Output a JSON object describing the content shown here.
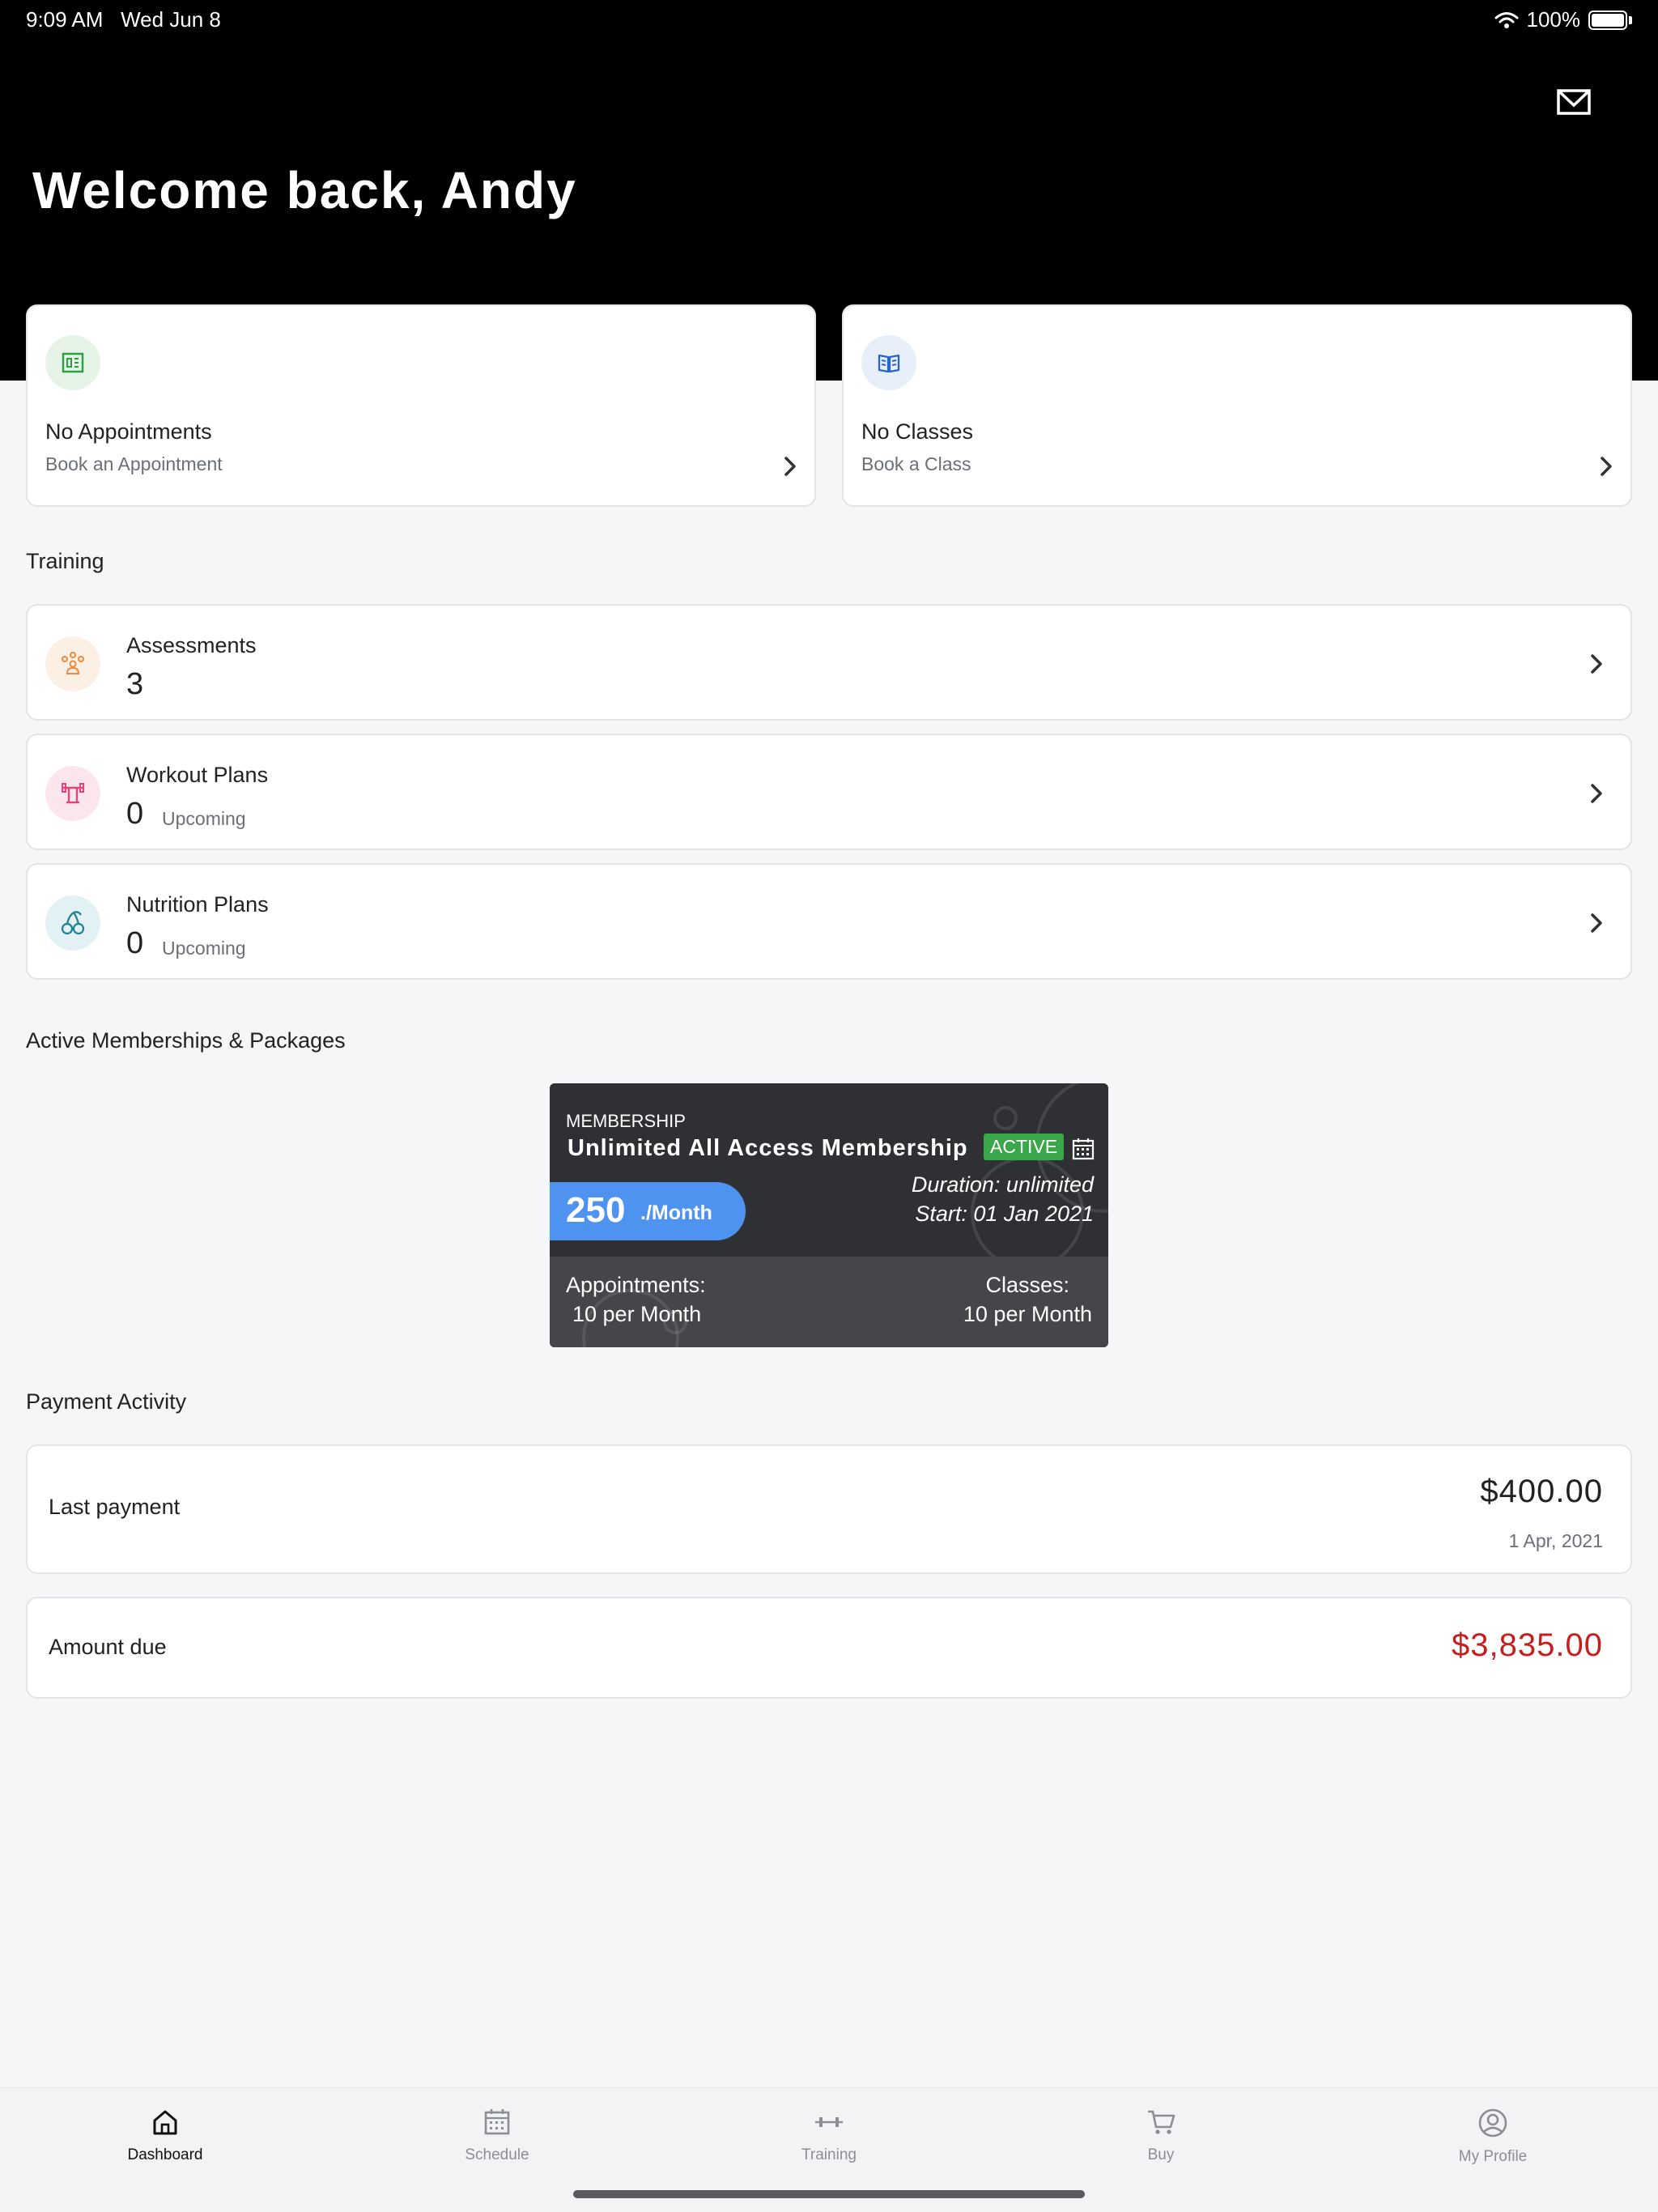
{
  "status_bar": {
    "time": "9:09 AM",
    "date": "Wed Jun 8",
    "battery": "100%"
  },
  "header": {
    "welcome": "Welcome back, Andy"
  },
  "quick_cards": {
    "appointments": {
      "title": "No Appointments",
      "subtitle": "Book an Appointment"
    },
    "classes": {
      "title": "No Classes",
      "subtitle": "Book a Class"
    }
  },
  "training": {
    "section_title": "Training",
    "items": [
      {
        "title": "Assessments",
        "count": "3",
        "sub": ""
      },
      {
        "title": "Workout Plans",
        "count": "0",
        "sub": "Upcoming"
      },
      {
        "title": "Nutrition Plans",
        "count": "0",
        "sub": "Upcoming"
      }
    ]
  },
  "memberships": {
    "section_title": "Active Memberships & Packages",
    "card": {
      "type": "MEMBERSHIP",
      "name": "Unlimited All Access Membership",
      "status": "ACTIVE",
      "price": "250",
      "period": "./Month",
      "duration": "Duration: unlimited",
      "start": "Start: 01 Jan 2021",
      "appointments_label": "Appointments:",
      "appointments_value": "10 per Month",
      "classes_label": "Classes:",
      "classes_value": "10 per Month"
    }
  },
  "payments": {
    "section_title": "Payment Activity",
    "last": {
      "label": "Last payment",
      "amount": "$400.00",
      "date": "1 Apr, 2021"
    },
    "due": {
      "label": "Amount due",
      "amount": "$3,835.00"
    }
  },
  "tabbar": {
    "tabs": [
      {
        "label": "Dashboard",
        "icon": "home-icon",
        "active": true
      },
      {
        "label": "Schedule",
        "icon": "calendar-icon",
        "active": false
      },
      {
        "label": "Training",
        "icon": "dumbbell-icon",
        "active": false
      },
      {
        "label": "Buy",
        "icon": "cart-icon",
        "active": false
      },
      {
        "label": "My Profile",
        "icon": "user-circle-icon",
        "active": false
      }
    ]
  },
  "colors": {
    "header_bg": "#000000",
    "accent_blue": "#4f93f0",
    "active_green": "#3aa84a",
    "due_red": "#c51f1f",
    "page_bg": "#f5f6f8"
  }
}
